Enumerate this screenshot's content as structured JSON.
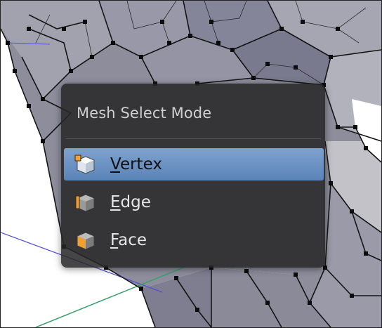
{
  "menu": {
    "title": "Mesh Select Mode",
    "items": [
      {
        "first_letter": "V",
        "rest": "ertex",
        "selected": true,
        "icon": "vertex-select-icon"
      },
      {
        "first_letter": "E",
        "rest": "dge",
        "selected": false,
        "icon": "edge-select-icon"
      },
      {
        "first_letter": "F",
        "rest": "ace",
        "selected": false,
        "icon": "face-select-icon"
      }
    ]
  },
  "colors": {
    "menu_bg": "#262626",
    "highlight": "#6c92c4",
    "mesh": "#8f8fa0",
    "x_axis": "#5050d8",
    "y_axis": "#3aa06a",
    "accent_orange": "#f0a030"
  }
}
